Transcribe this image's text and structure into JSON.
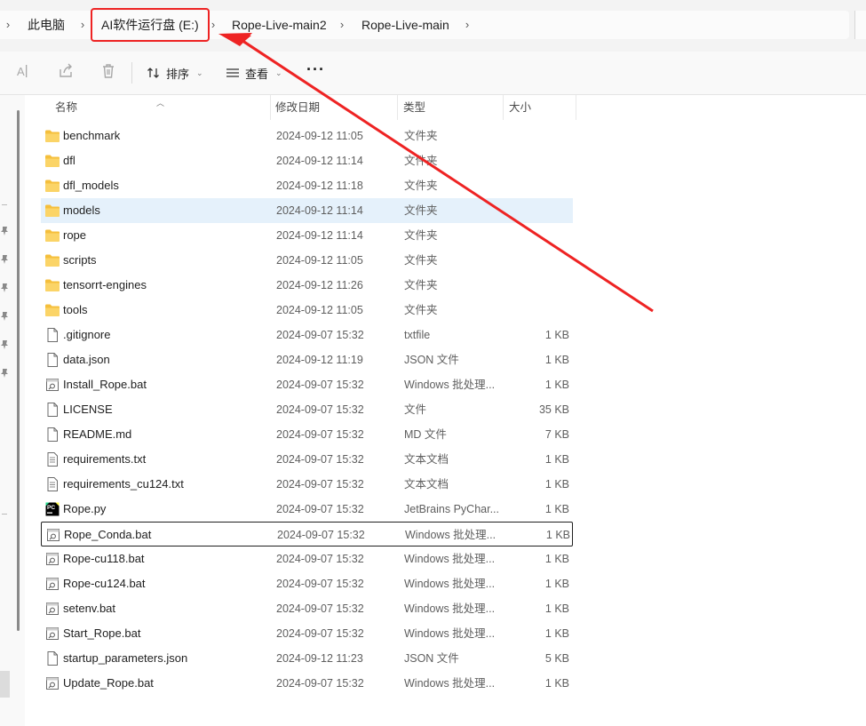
{
  "breadcrumb": {
    "items": [
      "此电脑",
      "AI软件运行盘 (E:)",
      "Rope-Live-main2",
      "Rope-Live-main"
    ]
  },
  "toolbar": {
    "sort_label": "排序",
    "view_label": "查看",
    "more_label": "···"
  },
  "columns": {
    "name": "名称",
    "date": "修改日期",
    "type": "类型",
    "size": "大小"
  },
  "files": [
    {
      "name": "benchmark",
      "date": "2024-09-12 11:05",
      "type": "文件夹",
      "size": "",
      "icon": "folder-icon"
    },
    {
      "name": "dfl",
      "date": "2024-09-12 11:14",
      "type": "文件夹",
      "size": "",
      "icon": "folder-icon"
    },
    {
      "name": "dfl_models",
      "date": "2024-09-12 11:18",
      "type": "文件夹",
      "size": "",
      "icon": "folder-icon"
    },
    {
      "name": "models",
      "date": "2024-09-12 11:14",
      "type": "文件夹",
      "size": "",
      "icon": "folder-icon",
      "selected": true
    },
    {
      "name": "rope",
      "date": "2024-09-12 11:14",
      "type": "文件夹",
      "size": "",
      "icon": "folder-icon"
    },
    {
      "name": "scripts",
      "date": "2024-09-12 11:05",
      "type": "文件夹",
      "size": "",
      "icon": "folder-icon"
    },
    {
      "name": "tensorrt-engines",
      "date": "2024-09-12 11:26",
      "type": "文件夹",
      "size": "",
      "icon": "folder-icon"
    },
    {
      "name": "tools",
      "date": "2024-09-12 11:05",
      "type": "文件夹",
      "size": "",
      "icon": "folder-icon"
    },
    {
      "name": ".gitignore",
      "date": "2024-09-07 15:32",
      "type": "txtfile",
      "size": "1 KB",
      "icon": "file-icon"
    },
    {
      "name": "data.json",
      "date": "2024-09-12 11:19",
      "type": "JSON 文件",
      "size": "1 KB",
      "icon": "file-icon"
    },
    {
      "name": "Install_Rope.bat",
      "date": "2024-09-07 15:32",
      "type": "Windows 批处理...",
      "size": "1 KB",
      "icon": "batch-file-icon"
    },
    {
      "name": "LICENSE",
      "date": "2024-09-07 15:32",
      "type": "文件",
      "size": "35 KB",
      "icon": "file-icon"
    },
    {
      "name": "README.md",
      "date": "2024-09-07 15:32",
      "type": "MD 文件",
      "size": "7 KB",
      "icon": "file-icon"
    },
    {
      "name": "requirements.txt",
      "date": "2024-09-07 15:32",
      "type": "文本文档",
      "size": "1 KB",
      "icon": "text-file-icon"
    },
    {
      "name": "requirements_cu124.txt",
      "date": "2024-09-07 15:32",
      "type": "文本文档",
      "size": "1 KB",
      "icon": "text-file-icon"
    },
    {
      "name": "Rope.py",
      "date": "2024-09-07 15:32",
      "type": "JetBrains PyChar...",
      "size": "1 KB",
      "icon": "pycharm-icon"
    },
    {
      "name": "Rope_Conda.bat",
      "date": "2024-09-07 15:32",
      "type": "Windows 批处理...",
      "size": "1 KB",
      "icon": "batch-file-icon",
      "focused": true
    },
    {
      "name": "Rope-cu118.bat",
      "date": "2024-09-07 15:32",
      "type": "Windows 批处理...",
      "size": "1 KB",
      "icon": "batch-file-icon"
    },
    {
      "name": "Rope-cu124.bat",
      "date": "2024-09-07 15:32",
      "type": "Windows 批处理...",
      "size": "1 KB",
      "icon": "batch-file-icon"
    },
    {
      "name": "setenv.bat",
      "date": "2024-09-07 15:32",
      "type": "Windows 批处理...",
      "size": "1 KB",
      "icon": "batch-file-icon"
    },
    {
      "name": "Start_Rope.bat",
      "date": "2024-09-07 15:32",
      "type": "Windows 批处理...",
      "size": "1 KB",
      "icon": "batch-file-icon"
    },
    {
      "name": "startup_parameters.json",
      "date": "2024-09-12 11:23",
      "type": "JSON 文件",
      "size": "5 KB",
      "icon": "file-icon"
    },
    {
      "name": "Update_Rope.bat",
      "date": "2024-09-07 15:32",
      "type": "Windows 批处理...",
      "size": "1 KB",
      "icon": "batch-file-icon"
    }
  ],
  "colors": {
    "annotation": "#ee2323",
    "folder": "#f7c948",
    "selected_row": "#e5f1fb"
  }
}
